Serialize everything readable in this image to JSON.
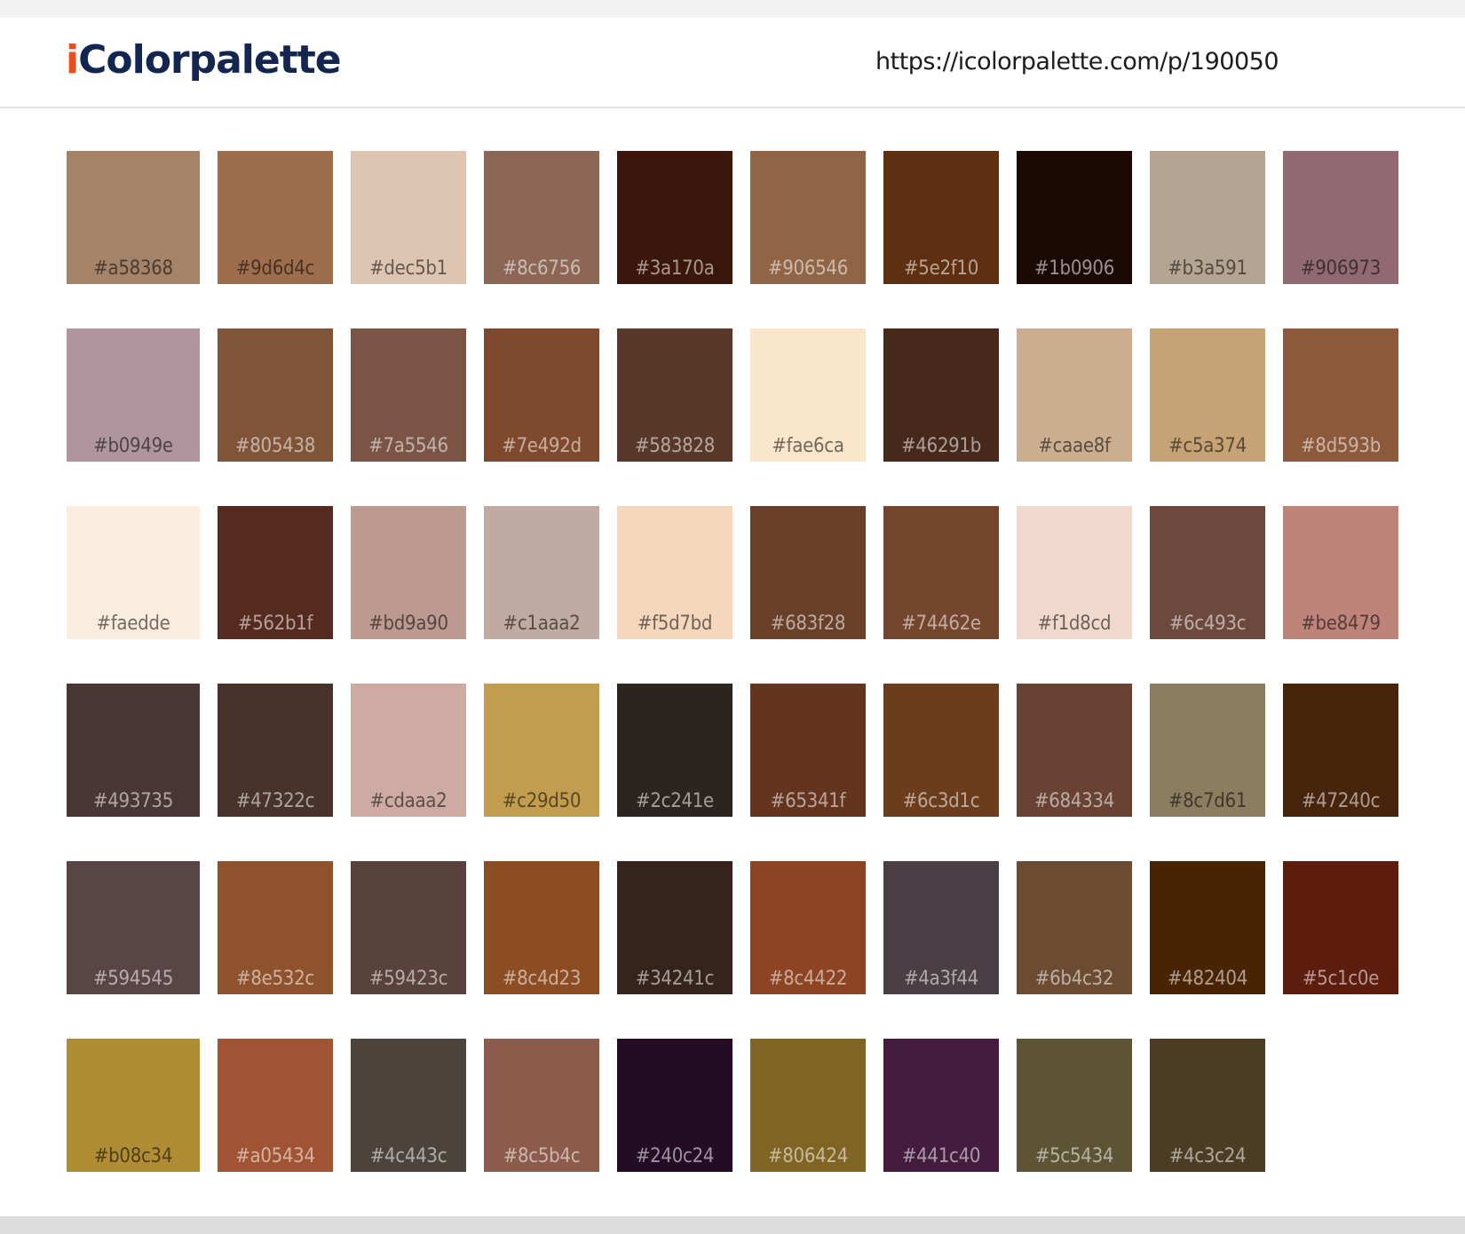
{
  "header": {
    "logo_accent": "i",
    "logo_text": "Colorpalette",
    "url": "https://icolorpalette.com/p/190050"
  },
  "colors": [
    "#a58368",
    "#9d6d4c",
    "#dec5b1",
    "#8c6756",
    "#3a170a",
    "#906546",
    "#5e2f10",
    "#1b0906",
    "#b3a591",
    "#906973",
    "#b0949e",
    "#805438",
    "#7a5546",
    "#7e492d",
    "#583828",
    "#fae6ca",
    "#46291b",
    "#caae8f",
    "#c5a374",
    "#8d593b",
    "#faedde",
    "#562b1f",
    "#bd9a90",
    "#c1aaa2",
    "#f5d7bd",
    "#683f28",
    "#74462e",
    "#f1d8cd",
    "#6c493c",
    "#be8479",
    "#493735",
    "#47322c",
    "#cdaaa2",
    "#c29d50",
    "#2c241e",
    "#65341f",
    "#6c3d1c",
    "#684334",
    "#8c7d61",
    "#47240c",
    "#594545",
    "#8e532c",
    "#59423c",
    "#8c4d23",
    "#34241c",
    "#8c4422",
    "#4a3f44",
    "#6b4c32",
    "#482404",
    "#5c1c0e",
    "#b08c34",
    "#a05434",
    "#4c443c",
    "#8c5b4c",
    "#240c24",
    "#806424",
    "#441c40",
    "#5c5434",
    "#4c3c24"
  ]
}
